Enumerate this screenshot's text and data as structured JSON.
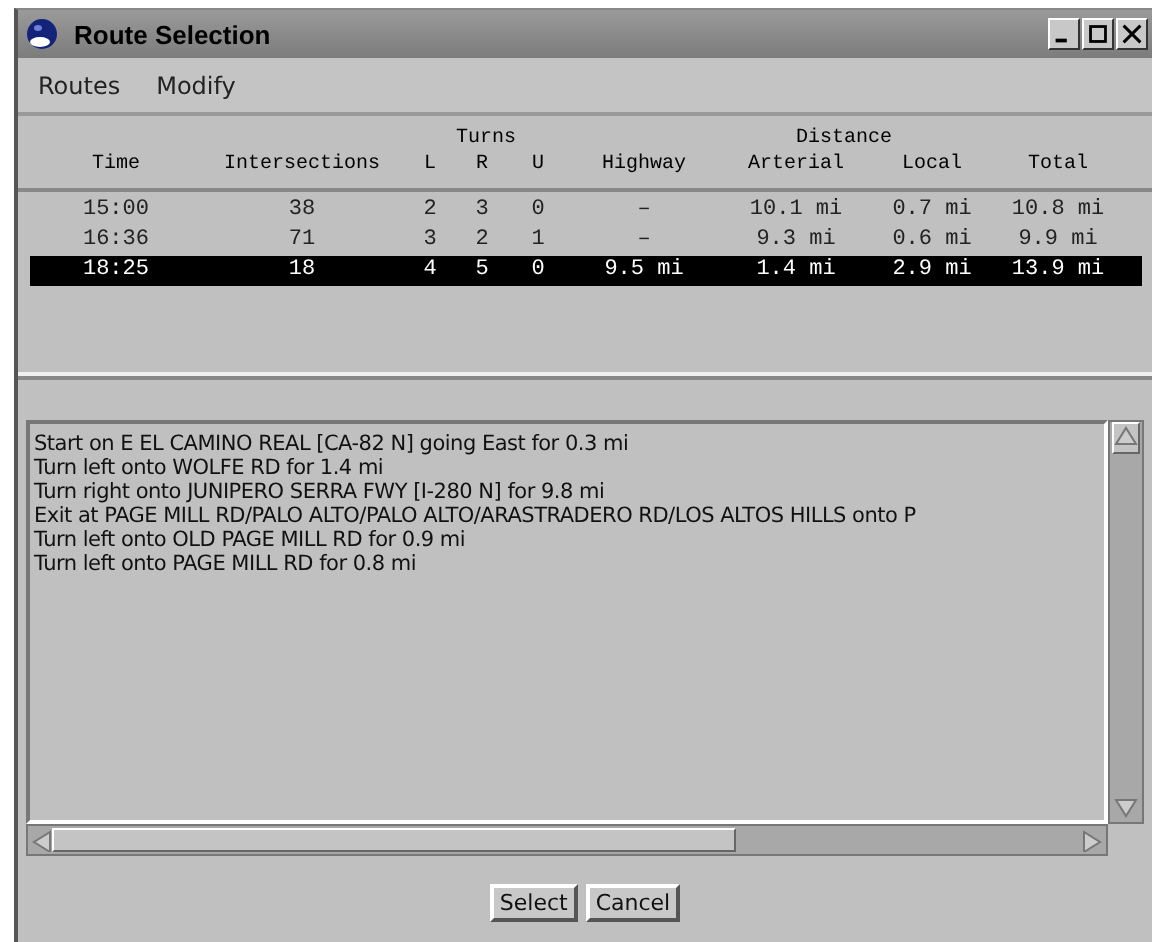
{
  "window": {
    "title": "Route Selection"
  },
  "menu": [
    "Routes",
    "Modify"
  ],
  "table": {
    "groups": [
      "Turns",
      "Distance"
    ],
    "columns": [
      "Time",
      "Intersections",
      "L",
      "R",
      "U",
      "Highway",
      "Arterial",
      "Local",
      "Total"
    ],
    "rows": [
      {
        "selected": false,
        "cells": [
          "15:00",
          "38",
          "2",
          "3",
          "0",
          "–",
          "10.1 mi",
          "0.7 mi",
          "10.8 mi"
        ]
      },
      {
        "selected": false,
        "cells": [
          "16:36",
          "71",
          "3",
          "2",
          "1",
          "–",
          "9.3 mi",
          "0.6 mi",
          "9.9 mi"
        ]
      },
      {
        "selected": true,
        "cells": [
          "18:25",
          "18",
          "4",
          "5",
          "0",
          "9.5 mi",
          "1.4 mi",
          "2.9 mi",
          "13.9 mi"
        ]
      }
    ]
  },
  "directions": [
    "Start on E EL CAMINO REAL [CA-82 N] going East for 0.3 mi",
    "Turn left onto WOLFE RD for 1.4 mi",
    "Turn right onto JUNIPERO SERRA FWY [I-280 N] for 9.8 mi",
    "Exit at PAGE MILL RD/PALO ALTO/PALO ALTO/ARASTRADERO RD/LOS ALTOS HILLS onto P",
    "Turn left onto OLD PAGE MILL RD for 0.9 mi",
    "Turn left onto PAGE MILL RD for 0.8 mi"
  ],
  "buttons": [
    "Select",
    "Cancel"
  ]
}
